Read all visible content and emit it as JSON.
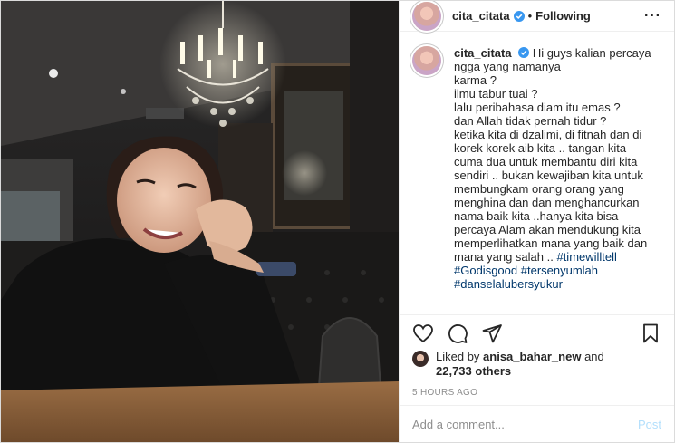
{
  "post": {
    "photo_description_icon": "photo"
  },
  "header": {
    "username": "cita_citata",
    "separator": "•",
    "follow_status": "Following",
    "more_label": "···"
  },
  "caption": {
    "username": "cita_citata",
    "lines": [
      "Hi guys kalian percaya",
      "ngga yang namanya",
      "karma ?",
      "ilmu tabur tuai ?",
      "lalu peribahasa diam itu emas ?",
      "dan Allah tidak pernah tidur ?",
      "ketika kita di dzalimi, di fitnah dan di",
      "korek korek aib kita .. tangan kita",
      "cuma dua untuk membantu diri kita",
      "sendiri .. bukan kewajiban kita untuk",
      "membungkam orang orang yang",
      "menghina dan dan menghancurkan",
      "nama baik kita ..hanya kita bisa",
      "percaya Alam akan mendukung kita",
      "memperlihatkan mana yang baik dan",
      "mana yang salah .. "
    ],
    "hashtags": {
      "first": "#timewilltell",
      "second": "#Godisgood",
      "third": "#tersenyumlah",
      "fourth": "#danselalubersyukur"
    }
  },
  "likes": {
    "prefix": "Liked by",
    "user": "anisa_bahar_new",
    "and": "and",
    "count": "22,733 others"
  },
  "timestamp": "5 HOURS AGO",
  "comment_box": {
    "placeholder": "Add a comment...",
    "post_label": "Post"
  },
  "colors": {
    "link": "#00376b",
    "verified": "#3897f0",
    "post_disabled": "#b2dffc"
  }
}
